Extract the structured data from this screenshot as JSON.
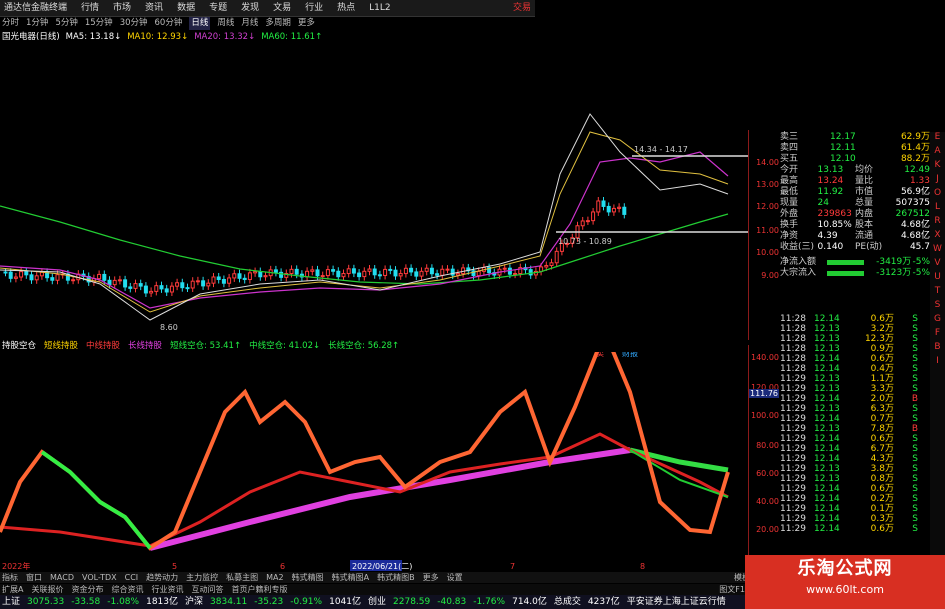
{
  "menu": {
    "app": "通达信金融终端",
    "items": [
      "行情",
      "市场",
      "资讯",
      "数据",
      "专题",
      "发现",
      "文易",
      "行业",
      "热点",
      "L1L2"
    ],
    "trade": "交易"
  },
  "periods": [
    "分时",
    "1分钟",
    "5分钟",
    "15分钟",
    "30分钟",
    "60分钟",
    "日线",
    "周线",
    "月线",
    "多周期",
    "更多"
  ],
  "active_period": "日线",
  "ma_legend": {
    "stock": "国光电器(日线)",
    "ma5": "MA5: 13.18↓",
    "ma10": "MA10: 12.93↓",
    "ma20": "MA20: 13.32↓",
    "ma60": "MA60: 11.61↑"
  },
  "main_annotations": {
    "high": "14.34 - 14.17",
    "mid": "10.73 - 10.89",
    "low": "8.60"
  },
  "main_axis": [
    "14.00",
    "13.00",
    "12.00",
    "11.00",
    "10.00",
    "9.00"
  ],
  "sub_legend": {
    "name": "持股空仓",
    "l1": "短线持股",
    "l2": "中线持股",
    "l3": "长线持股",
    "l4": "短线空仓: 53.41↑",
    "l5": "中线空仓: 41.02↓",
    "l6": "长线空仓: 56.28↑"
  },
  "sub_axis": [
    "140.00",
    "120.00",
    "100.00",
    "80.00",
    "60.00",
    "40.00",
    "20.00"
  ],
  "sub_cursor": "111.76",
  "sub_marks": {
    "m1": "卖",
    "m2": "财报"
  },
  "quote": [
    {
      "k": "卖三",
      "v": "12.17",
      "n": "62.9万"
    },
    {
      "k": "卖四",
      "v": "12.11",
      "n": "61.4万"
    },
    {
      "k": "买五",
      "v": "12.10",
      "n": "88.2万"
    },
    {
      "k": "今开",
      "v": "13.13",
      "k2": "均价",
      "v2": "12.49"
    },
    {
      "k": "最高",
      "v": "13.24",
      "k2": "量比",
      "v2": "1.33"
    },
    {
      "k": "最低",
      "v": "11.92",
      "k2": "市值",
      "v2": "56.9亿"
    },
    {
      "k": "现量",
      "v": "24",
      "k2": "总量",
      "v2": "507375"
    },
    {
      "k": "外盘",
      "v": "239863",
      "k2": "内盘",
      "v2": "267512"
    },
    {
      "k": "换手",
      "v": "10.85%",
      "k2": "股本",
      "v2": "4.68亿"
    },
    {
      "k": "净资",
      "v": "4.39",
      "k2": "流通",
      "v2": "4.68亿"
    },
    {
      "k": "收益(三)",
      "v": "0.140",
      "k2": "PE(动)",
      "v2": "45.7"
    }
  ],
  "flows": [
    {
      "k": "净流入额",
      "v": "-3419万",
      "p": "-5%"
    },
    {
      "k": "大宗流入",
      "v": "-3123万",
      "p": "-5%"
    }
  ],
  "ticks": [
    [
      "11:28",
      "12.14",
      "0.6万",
      "S"
    ],
    [
      "11:28",
      "12.13",
      "3.2万",
      "S"
    ],
    [
      "11:28",
      "12.13",
      "12.3万",
      "S"
    ],
    [
      "11:28",
      "12.13",
      "0.9万",
      "S"
    ],
    [
      "11:28",
      "12.14",
      "0.6万",
      "S"
    ],
    [
      "11:28",
      "12.14",
      "0.4万",
      "S"
    ],
    [
      "11:29",
      "12.13",
      "1.1万",
      "S"
    ],
    [
      "11:29",
      "12.13",
      "3.3万",
      "S"
    ],
    [
      "11:29",
      "12.14",
      "2.0万",
      "B"
    ],
    [
      "11:29",
      "12.13",
      "6.3万",
      "S"
    ],
    [
      "11:29",
      "12.14",
      "0.7万",
      "S"
    ],
    [
      "11:29",
      "12.13",
      "7.8万",
      "B"
    ],
    [
      "11:29",
      "12.14",
      "0.6万",
      "S"
    ],
    [
      "11:29",
      "12.14",
      "6.7万",
      "S"
    ],
    [
      "11:29",
      "12.14",
      "4.3万",
      "S"
    ],
    [
      "11:29",
      "12.13",
      "3.8万",
      "S"
    ],
    [
      "11:29",
      "12.13",
      "0.8万",
      "S"
    ],
    [
      "11:29",
      "12.14",
      "0.6万",
      "S"
    ],
    [
      "11:29",
      "12.14",
      "0.2万",
      "S"
    ],
    [
      "11:29",
      "12.14",
      "0.1万",
      "S"
    ],
    [
      "11:29",
      "12.14",
      "0.3万",
      "S"
    ],
    [
      "11:29",
      "12.14",
      "0.6万",
      "S"
    ]
  ],
  "right_strip": [
    "E",
    "A",
    "K",
    "J",
    "O",
    "L",
    "R",
    "X",
    "W",
    "V",
    "U",
    "T",
    "S",
    "G",
    "F",
    "B",
    "I"
  ],
  "date_axis": {
    "left": "2022年",
    "center": "2022/06/21(二)",
    "n1": "5",
    "n2": "6",
    "n3": "7",
    "n4": "8"
  },
  "bottom_tabs": [
    "指标",
    "窗口",
    "MACD",
    "VOL-TDX",
    "CCI",
    "趋势动力",
    "主力监控",
    "私募主图",
    "MA2",
    "韩式精图",
    "韩式精图A",
    "韩式精图B",
    "更多",
    "设置"
  ],
  "bottom_tabs2": [
    "扩展A",
    "关联报价",
    "资金分布",
    "综合资讯",
    "行业资讯",
    "互动问答",
    "首页户籍利专版"
  ],
  "bottom_right": "图文F10",
  "bottom_right2": "模板",
  "status": {
    "sh": "上证",
    "sh_val": "3075.33",
    "sh_chg": "-33.58",
    "sh_pct": "-1.08%",
    "sh_amt": "1813亿",
    "sz": "沪深",
    "sz_val": "3834.11",
    "sz_chg": "-35.23",
    "sz_pct": "-0.91%",
    "sz_amt": "1041亿",
    "cy": "创业",
    "cy_val": "2278.59",
    "cy_chg": "-40.83",
    "cy_pct": "-1.76%",
    "cy_amt": "714.0亿",
    "total": "总成交",
    "total_amt": "4237亿",
    "broker": "平安证券上海上证云行情"
  },
  "watermark": {
    "title": "乐淘公式网",
    "url": "www.60lt.com"
  }
}
